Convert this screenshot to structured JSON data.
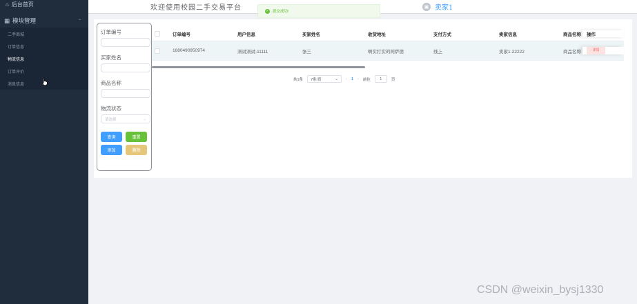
{
  "sidebar": {
    "home_label": "后台首页",
    "group_label": "模块管理",
    "items": [
      {
        "label": "二手商城"
      },
      {
        "label": "订单信息"
      },
      {
        "label": "物流信息"
      },
      {
        "label": "订单评价"
      },
      {
        "label": "消息信息"
      }
    ],
    "active_item": "物流信息"
  },
  "header": {
    "welcome": "欢迎使用校园二手交易平台",
    "username": "卖家1"
  },
  "toast": {
    "text": "提交成功!",
    "color": "#67c23a"
  },
  "filters": {
    "order_no_label": "订单编号",
    "buyer_name_label": "买家姓名",
    "product_name_label": "商品名称",
    "logistics_status_label": "物流状态",
    "status_placeholder": "请选择",
    "query_button": "查询",
    "reset_button": "重置",
    "add_button": "添加",
    "delete_button": "删除"
  },
  "table": {
    "headers": [
      "订单编号",
      "用户信息",
      "买家姓名",
      "收货地址",
      "支付方式",
      "卖家信息",
      "商品名称",
      "操作"
    ],
    "rows": [
      {
        "order_no": "1680490950974",
        "user_info": "测试测试-11111",
        "buyer_name": "张三",
        "address": "啊实打实的阿萨德",
        "payment": "线上",
        "seller_info": "卖家1-22222",
        "product_name": "商品名称",
        "action": "详情"
      }
    ]
  },
  "pagination": {
    "total": "共1条",
    "page_size": "7条/页",
    "current_page": "1",
    "goto_label": "前往",
    "goto_value": "1",
    "page_suffix": "页"
  },
  "watermark": "CSDN @weixin_bysj1330",
  "colors": {
    "sidebar": "#1f2d3d",
    "primary": "#409eff",
    "success": "#67c23a",
    "warning": "#e6c77a",
    "danger": "#f56c6c"
  }
}
